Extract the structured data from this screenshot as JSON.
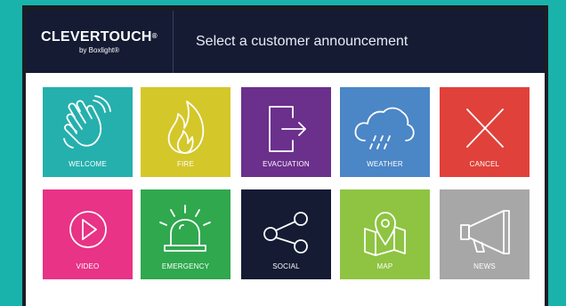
{
  "header": {
    "logo_main": "CLEVERTOUCH",
    "logo_reg": "®",
    "logo_sub": "by Boxlight®",
    "title": "Select a customer announcement"
  },
  "tiles": [
    {
      "label": "WELCOME",
      "icon": "wave-hand-icon",
      "color": "#25b0ad"
    },
    {
      "label": "FIRE",
      "icon": "flame-icon",
      "color": "#d4c72a"
    },
    {
      "label": "EVACUATION",
      "icon": "exit-door-icon",
      "color": "#6b2f8c"
    },
    {
      "label": "WEATHER",
      "icon": "rain-cloud-icon",
      "color": "#4b86c7"
    },
    {
      "label": "CANCEL",
      "icon": "close-icon",
      "color": "#e0413a"
    },
    {
      "label": "VIDEO",
      "icon": "play-icon",
      "color": "#e83387"
    },
    {
      "label": "EMERGENCY",
      "icon": "siren-icon",
      "color": "#2fa84e"
    },
    {
      "label": "SOCIAL",
      "icon": "share-icon",
      "color": "#141b33"
    },
    {
      "label": "MAP",
      "icon": "map-pin-icon",
      "color": "#8ec442"
    },
    {
      "label": "NEWS",
      "icon": "megaphone-icon",
      "color": "#a7a7a7"
    }
  ],
  "colors": {
    "background": "#1ab3ac",
    "header": "#141b33"
  }
}
